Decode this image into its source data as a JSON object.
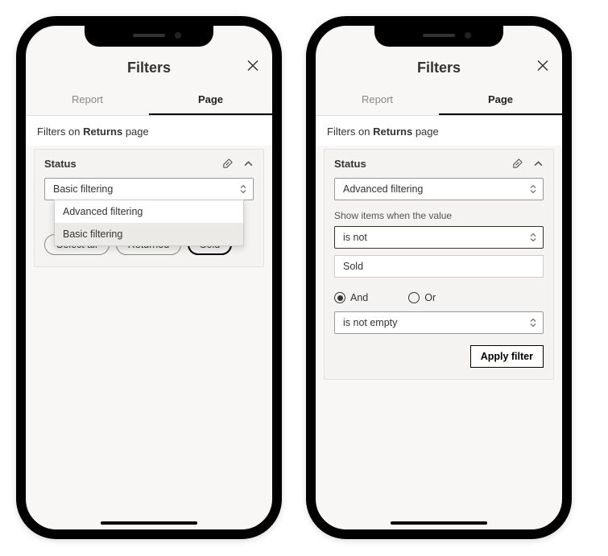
{
  "header": {
    "title": "Filters"
  },
  "tabs": {
    "report": "Report",
    "page": "Page"
  },
  "section": {
    "prefix": "Filters on ",
    "bold": "Returns",
    "suffix": " page"
  },
  "card": {
    "title": "Status"
  },
  "left": {
    "select_value": "Basic filtering",
    "dropdown": {
      "advanced": "Advanced filtering",
      "basic": "Basic filtering"
    },
    "chips": {
      "select_all": "Select all",
      "returned": "Returned",
      "sold": "Sold"
    }
  },
  "right": {
    "select_value": "Advanced filtering",
    "show_label": "Show items when the value",
    "condition1": "is not",
    "value1": "Sold",
    "logic": {
      "and": "And",
      "or": "Or"
    },
    "condition2": "is not empty",
    "apply": "Apply filter"
  }
}
